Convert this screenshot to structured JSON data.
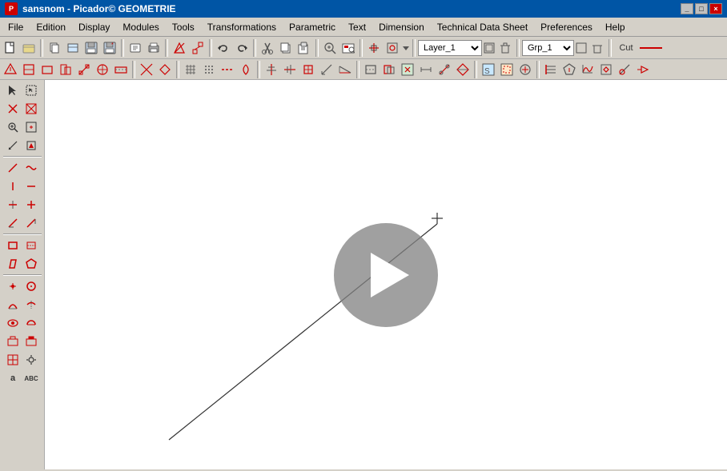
{
  "titleBar": {
    "title": "sansnom - Picador© GEOMETRIE",
    "iconLabel": "P"
  },
  "menuBar": {
    "items": [
      {
        "id": "file",
        "label": "File"
      },
      {
        "id": "edition",
        "label": "Edition"
      },
      {
        "id": "display",
        "label": "Display"
      },
      {
        "id": "modules",
        "label": "Modules"
      },
      {
        "id": "tools",
        "label": "Tools"
      },
      {
        "id": "transformations",
        "label": "Transformations"
      },
      {
        "id": "parametric",
        "label": "Parametric"
      },
      {
        "id": "text",
        "label": "Text"
      },
      {
        "id": "dimension",
        "label": "Dimension"
      },
      {
        "id": "technical-data-sheet",
        "label": "Technical Data Sheet"
      },
      {
        "id": "preferences",
        "label": "Preferences"
      },
      {
        "id": "help",
        "label": "Help"
      }
    ]
  },
  "toolbar1": {
    "layerCombo": "Layer_1",
    "grpCombo": "Grp_1",
    "cutLabel": "Cut",
    "lineColorLabel": "—"
  },
  "canvas": {
    "playButtonLabel": "▶"
  },
  "leftToolbar": {
    "rows": [
      [
        "▲",
        "▣"
      ],
      [
        "✕",
        "⊠"
      ],
      [
        "↗",
        "⊞"
      ],
      [
        "✎",
        "⊡"
      ],
      [
        "⟋",
        "∿"
      ],
      [
        "+",
        "—"
      ],
      [
        "⊢",
        "+"
      ],
      [
        "⊘",
        "⊘"
      ],
      [
        "⟳",
        "⌒"
      ],
      [
        "+",
        "◎"
      ],
      [
        "↺",
        "∪"
      ],
      [
        "◷",
        "◕"
      ],
      [
        "⊗",
        "⊡"
      ],
      [
        "⊞",
        "⊟"
      ],
      [
        "⊞",
        "⚙"
      ],
      [
        "a",
        "ABC"
      ]
    ]
  }
}
